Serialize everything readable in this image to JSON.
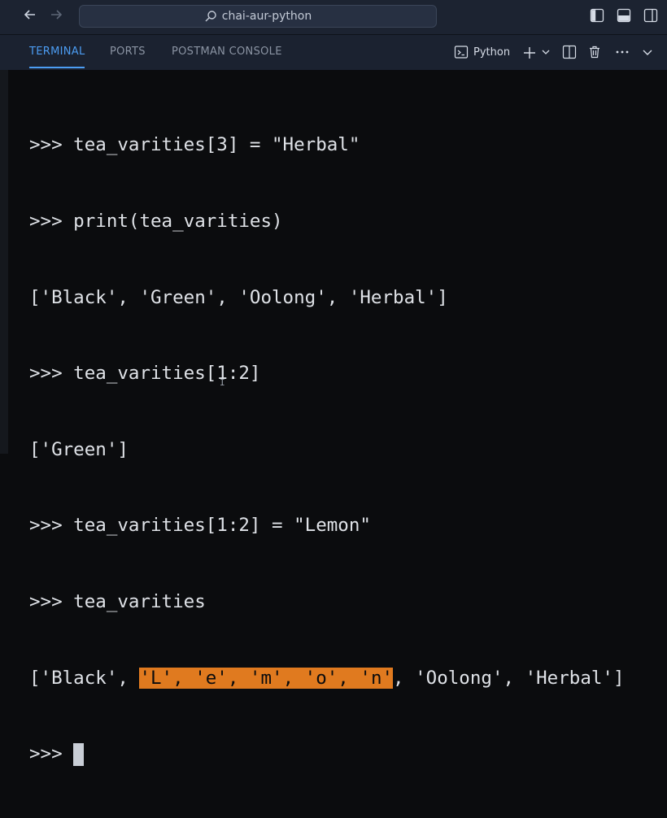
{
  "titlebar": {
    "search_text": "chai-aur-python",
    "icons": [
      "back-arrow-icon",
      "forward-arrow-icon",
      "search-icon",
      "toggle-primary-sidebar-icon",
      "toggle-panel-icon",
      "toggle-secondary-sidebar-icon"
    ]
  },
  "panel": {
    "tabs": [
      {
        "label": "TERMINAL",
        "active": true
      },
      {
        "label": "PORTS",
        "active": false
      },
      {
        "label": "POSTMAN CONSOLE",
        "active": false
      }
    ],
    "profile_label": "Python",
    "accent": "#4c9df3"
  },
  "terminal": {
    "lines": [
      ">>> tea_varities[3] = \"Herbal\"",
      ">>> print(tea_varities)",
      "['Black', 'Green', 'Oolong', 'Herbal']",
      ">>> tea_varities[1:2]",
      "['Green']",
      ">>> tea_varities[1:2] = \"Lemon\"",
      ">>> tea_varities"
    ],
    "result_line": {
      "before": "['Black', ",
      "highlighted": "'L', 'e', 'm', 'o', 'n'",
      "after": ", 'Oolong', 'Herbal']"
    },
    "prompt": ">>> ",
    "highlight_color": "#e07a1f"
  }
}
